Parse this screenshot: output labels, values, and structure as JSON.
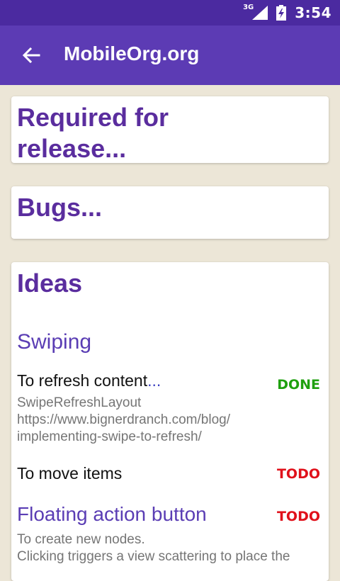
{
  "status_bar": {
    "network": "3G",
    "time": "3:54"
  },
  "app_bar": {
    "title": "MobileOrg.org",
    "back_icon": "arrow-back-icon"
  },
  "cards": [
    {
      "heading": "Required for\nrelease..."
    },
    {
      "heading": "Bugs..."
    },
    {
      "heading": "Ideas",
      "subheading": "Swiping",
      "items": [
        {
          "title": "To refresh content",
          "ellipsis": "...",
          "badge": "DONE",
          "body": "SwipeRefreshLayout\nhttps://www.bignerdranch.com/blog/\nimplementing-swipe-to-refresh/"
        },
        {
          "title": "To move items",
          "badge": "TODO"
        }
      ],
      "section2": {
        "title": "Floating action button",
        "badge": "TODO",
        "body": "To create new nodes.\nClicking triggers a view scattering to place the"
      }
    }
  ],
  "colors": {
    "status_bar": "#4b2aa0",
    "app_bar": "#5c3bb4",
    "background": "#ece6d7",
    "heading": "#5a2d9e",
    "done": "#1fa00f",
    "todo": "#e0101a"
  }
}
